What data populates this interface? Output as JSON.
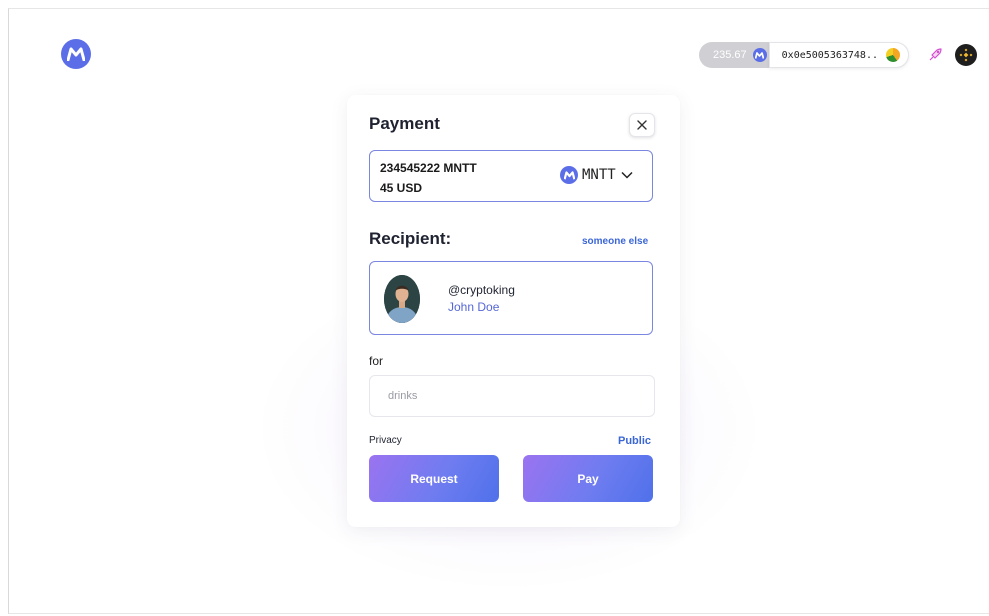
{
  "header": {
    "logo_icon": "m-logo-icon",
    "balance": "235.67",
    "address": "0x0e5005363748..",
    "colors": {
      "brand": "#5b6ee8",
      "link": "#3b66d6",
      "button_gradient_start": "#9b73f0",
      "button_gradient_end": "#4f71ea"
    }
  },
  "payment": {
    "title": "Payment",
    "amount_token": "234545222 MNTT",
    "amount_usd": "45 USD",
    "token_symbol": "MNTT"
  },
  "recipient": {
    "label": "Recipient:",
    "switch_link": "someone else",
    "handle": "@cryptoking",
    "name": "John Doe"
  },
  "note": {
    "label": "for",
    "placeholder": "drinks"
  },
  "privacy": {
    "label": "Privacy",
    "value": "Public"
  },
  "actions": {
    "request_label": "Request",
    "pay_label": "Pay"
  }
}
